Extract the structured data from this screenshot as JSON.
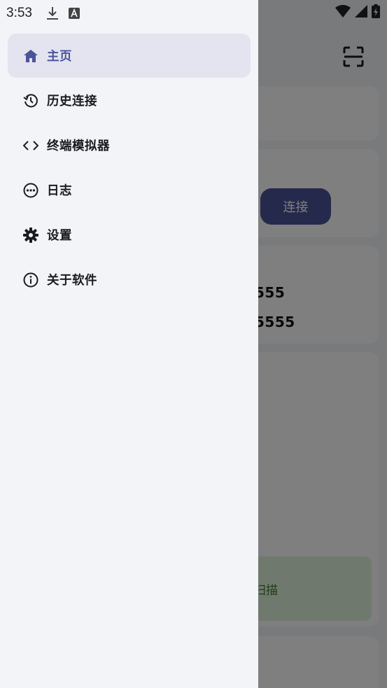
{
  "status_bar": {
    "time": "3:53"
  },
  "background": {
    "connect_button": "连接",
    "port_line_1": "555",
    "port_line_2": "5555",
    "scan_text": "扫描"
  },
  "drawer": {
    "items": [
      {
        "label": "主页",
        "icon": "home-icon",
        "active": true
      },
      {
        "label": "历史连接",
        "icon": "history-icon",
        "active": false
      },
      {
        "label": "终端模拟器",
        "icon": "code-icon",
        "active": false
      },
      {
        "label": "日志",
        "icon": "more-circle-icon",
        "active": false
      },
      {
        "label": "设置",
        "icon": "gear-icon",
        "active": false
      },
      {
        "label": "关于软件",
        "icon": "info-icon",
        "active": false
      }
    ]
  },
  "colors": {
    "accent": "#4b5499",
    "active_item_bg": "#e3e4f0",
    "drawer_bg": "#f3f4f8",
    "scrim": "rgba(0,0,0,0.5)"
  }
}
